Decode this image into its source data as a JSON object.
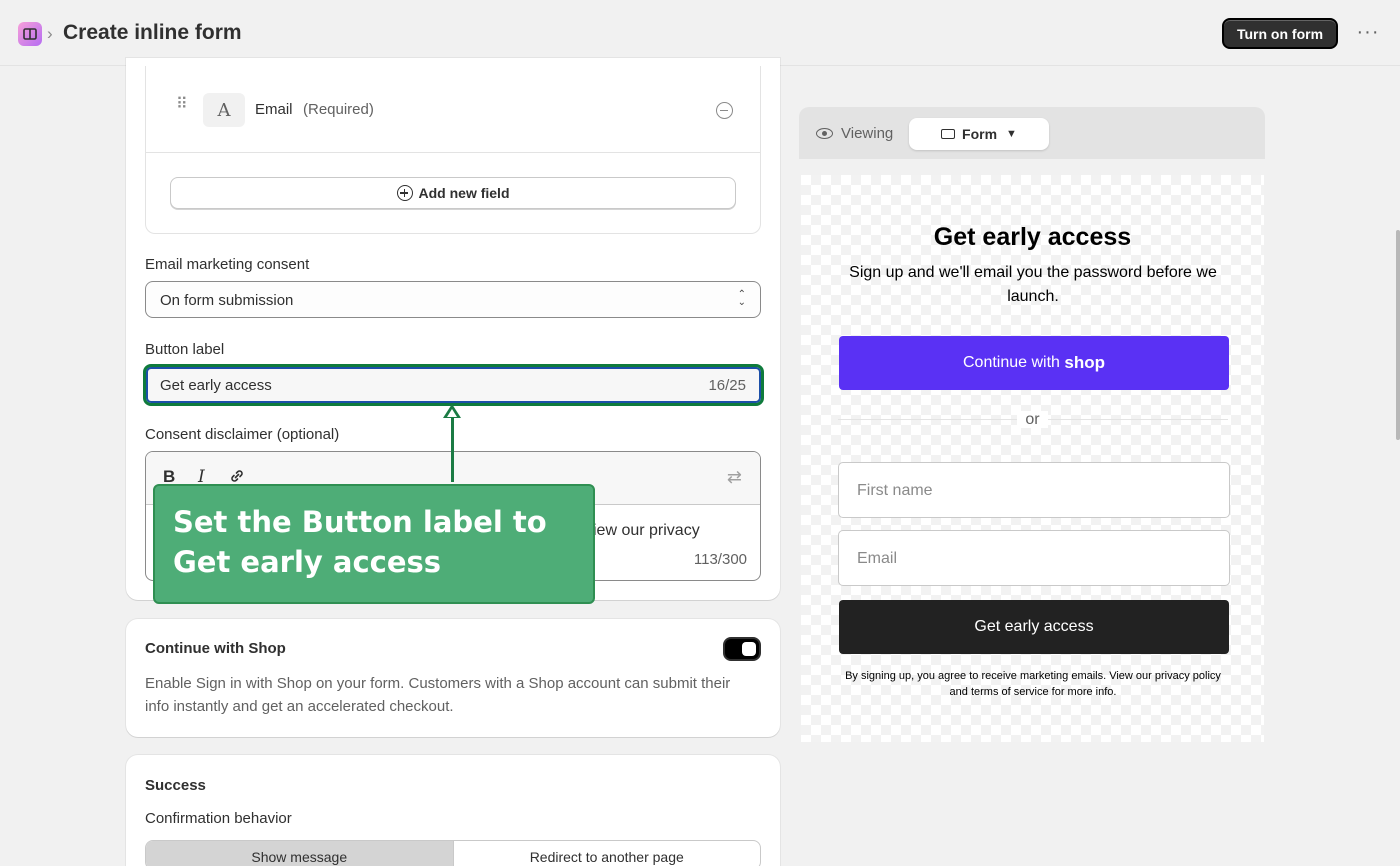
{
  "header": {
    "breadcrumb_sep": "›",
    "title": "Create inline form",
    "primary_button": "Turn on form",
    "more": "···"
  },
  "fields": {
    "item": {
      "type_icon": "A",
      "name": "Email",
      "note": "(Required)"
    },
    "add_button": "Add new field"
  },
  "consent": {
    "label": "Email marketing consent",
    "value": "On form submission",
    "chevron_up": "⌃",
    "chevron_down": "⌄"
  },
  "button_label": {
    "label": "Button label",
    "value": "Get early access",
    "count": "16/25"
  },
  "disclaimer": {
    "label": "Consent disclaimer (optional)",
    "toolbar": {
      "bold": "B",
      "italic": "I",
      "link": "🔗",
      "swap": "⇄"
    },
    "visible_text": "iew our privacy",
    "count": "113/300"
  },
  "callout": {
    "text": "Set the Button label to Get early access"
  },
  "shop_card": {
    "title": "Continue with Shop",
    "toggle_on": true,
    "description": "Enable Sign in with Shop on your form. Customers with a Shop account can submit their info instantly and get an accelerated checkout."
  },
  "success_card": {
    "title": "Success",
    "behavior_label": "Confirmation behavior",
    "options": [
      "Show message",
      "Redirect to another page"
    ],
    "selected": "Show message"
  },
  "preview": {
    "viewing_label": "Viewing",
    "view_option": "Form",
    "title": "Get early access",
    "subtitle": "Sign up and we'll email you the password before we launch.",
    "shop_button_prefix": "Continue with",
    "shop_button_brand": "shop",
    "or": "or",
    "first_name_placeholder": "First name",
    "email_placeholder": "Email",
    "submit": "Get early access",
    "disclaimer": "By signing up, you agree to receive marketing emails. View our privacy policy and terms of service for more info."
  },
  "colors": {
    "shop_purple": "#5a31f4",
    "callout_green": "#4ead77",
    "highlight_green": "#0f7b3c",
    "submit_dark": "#222222"
  }
}
